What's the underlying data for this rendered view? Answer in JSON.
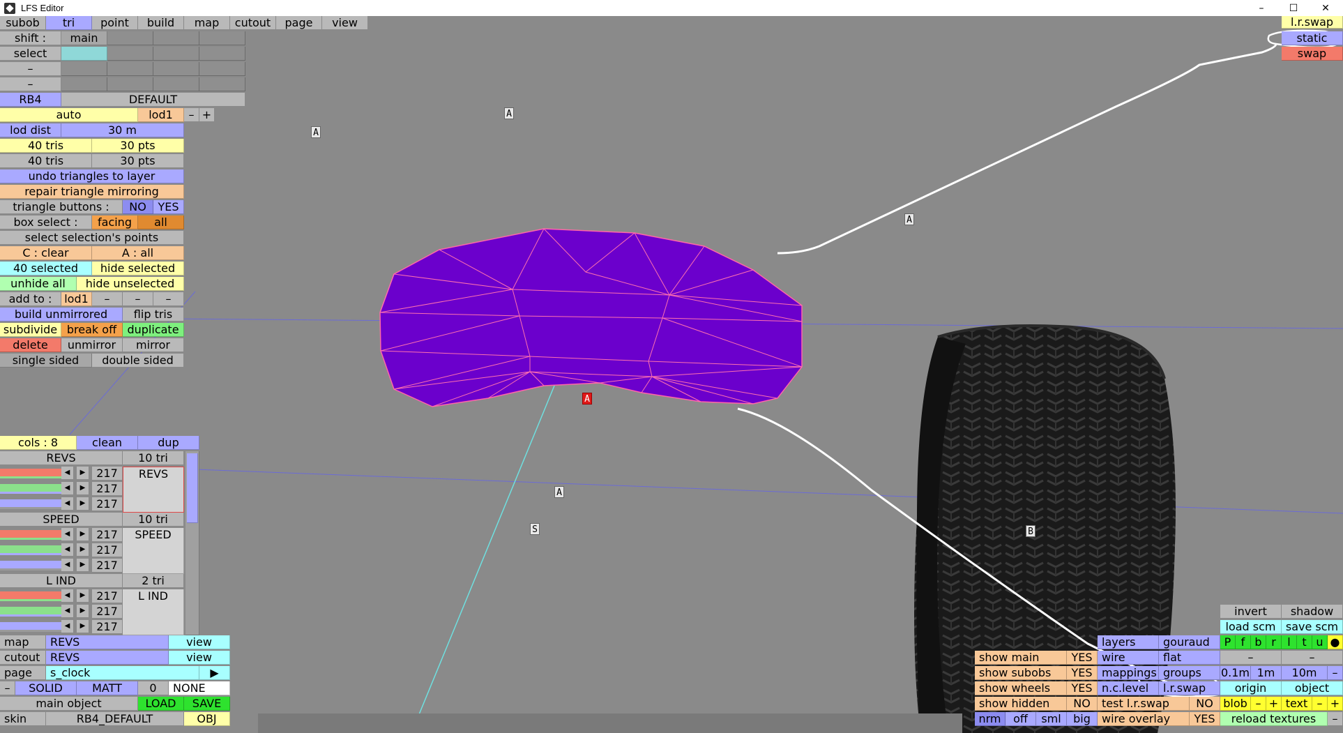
{
  "window": {
    "title": "LFS Editor",
    "controls": [
      "–",
      "☐",
      "✕"
    ]
  },
  "menu": [
    "subob",
    "tri",
    "point",
    "build",
    "map",
    "cutout",
    "page",
    "view"
  ],
  "left": {
    "shift_label": "shift :",
    "main": "main",
    "select": "select",
    "dash": "–",
    "rb4": "RB4",
    "default": "DEFAULT",
    "auto": "auto",
    "lod1": "lod1",
    "minus": "–",
    "plus": "+",
    "lod_dist": "lod dist",
    "lod_dist_val": "30 m",
    "tris_a": "40 tris",
    "pts_a": "30 pts",
    "tris_b": "40 tris",
    "pts_b": "30 pts",
    "undo_tri": "undo triangles to layer",
    "repair": "repair triangle mirroring",
    "tri_buttons": "triangle buttons :",
    "no": "NO",
    "yes": "YES",
    "box_select": "box select :",
    "facing": "facing",
    "all": "all",
    "select_sel_pts": "select selection's points",
    "c_clear": "C : clear",
    "a_all": "A : all",
    "selected": "40 selected",
    "hide_selected": "hide selected",
    "unhide_all": "unhide all",
    "hide_unselected": "hide unselected",
    "add_to": "add to :",
    "build_unmirrored": "build unmirrored",
    "flip_tris": "flip tris",
    "subdivide": "subdivide",
    "break_off": "break off",
    "duplicate": "duplicate",
    "delete": "delete",
    "unmirror": "unmirror",
    "mirror": "mirror",
    "single_sided": "single sided",
    "double_sided": "double sided"
  },
  "colors_panel": {
    "cols": "cols : 8",
    "clean": "clean",
    "dup": "dup",
    "groups": [
      {
        "name": "REVS",
        "tris": "10 tri",
        "values": [
          "217",
          "217",
          "217"
        ],
        "label": "REVS"
      },
      {
        "name": "SPEED",
        "tris": "10 tri",
        "values": [
          "217",
          "217",
          "217"
        ],
        "label": "SPEED"
      },
      {
        "name": "L IND",
        "tris": "2 tri",
        "values": [
          "217",
          "217",
          "217"
        ],
        "label": "L IND"
      }
    ],
    "slider_colors": [
      "#f37a6a",
      "#8be08b",
      "#a9a9ff",
      "#9a9a9a"
    ]
  },
  "bottom_left": {
    "map": "map",
    "map_val": "REVS",
    "view": "view",
    "cutout": "cutout",
    "cutout_val": "REVS",
    "page": "page",
    "page_val": "s_clock",
    "play": "▶",
    "minus": "–",
    "solid": "SOLID",
    "matt": "MATT",
    "zero": "0",
    "none": "NONE",
    "main_object": "main object",
    "load": "LOAD",
    "save": "SAVE",
    "skin": "skin",
    "skin_val": "RB4_DEFAULT",
    "obj": "OBJ"
  },
  "top_right": {
    "lr_swap": "l.r.swap",
    "static": "static",
    "swap": "swap"
  },
  "bottom_right": {
    "invert": "invert",
    "shadow": "shadow",
    "load_scm": "load scm",
    "save_scm": "save scm",
    "letters": [
      "P",
      "f",
      "b",
      "r",
      "l",
      "t",
      "u",
      "●"
    ],
    "layers": "layers",
    "gouraud": "gouraud",
    "wire": "wire",
    "flat": "flat",
    "dash": "–",
    "show_main": "show main",
    "show_subobs": "show subobs",
    "show_wheels": "show wheels",
    "show_hidden": "show hidden",
    "yes": "YES",
    "no": "NO",
    "mappings": "mappings",
    "groups": "groups",
    "nc_level": "n.c.level",
    "lr_swap": "l.r.swap",
    "test_lr_swap": "test l.r.swap",
    "wire_overlay": "wire overlay",
    "dist_01": "0.1m",
    "dist_1": "1m",
    "dist_10": "10m",
    "origin": "origin",
    "object": "object",
    "blob": "blob",
    "text": "text",
    "plus": "+",
    "nrm": "nrm",
    "off": "off",
    "sml": "sml",
    "big": "big",
    "reload_textures": "reload textures"
  },
  "scene_tags": {
    "a": "A",
    "b": "B",
    "s": "S"
  }
}
